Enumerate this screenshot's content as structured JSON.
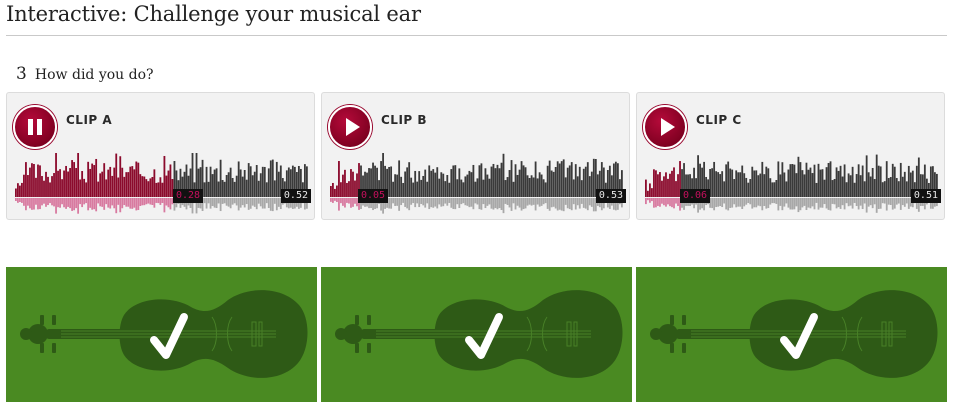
{
  "header": {
    "title": "Interactive: Challenge your musical ear"
  },
  "section": {
    "number": "3",
    "text": "How did you do?"
  },
  "colors": {
    "accent": "#8b0a2c",
    "played": "#8b0a2c",
    "unplayed": "#3a3a3a",
    "result_bg": "#4a8a22"
  },
  "clips": [
    {
      "label": "CLIP A",
      "state": "playing",
      "icon": "pause-icon",
      "current": "0.28",
      "duration": "0.52",
      "progress": 0.54
    },
    {
      "label": "CLIP B",
      "state": "paused",
      "icon": "play-icon",
      "current": "0.05",
      "duration": "0.53",
      "progress": 0.1
    },
    {
      "label": "CLIP C",
      "state": "paused",
      "icon": "play-icon",
      "current": "0.06",
      "duration": "0.51",
      "progress": 0.12
    }
  ],
  "results": [
    {
      "icon": "violin-icon",
      "mark": "checkmark-icon",
      "correct": true
    },
    {
      "icon": "violin-icon",
      "mark": "checkmark-icon",
      "correct": true
    },
    {
      "icon": "violin-icon",
      "mark": "checkmark-icon",
      "correct": true
    }
  ]
}
